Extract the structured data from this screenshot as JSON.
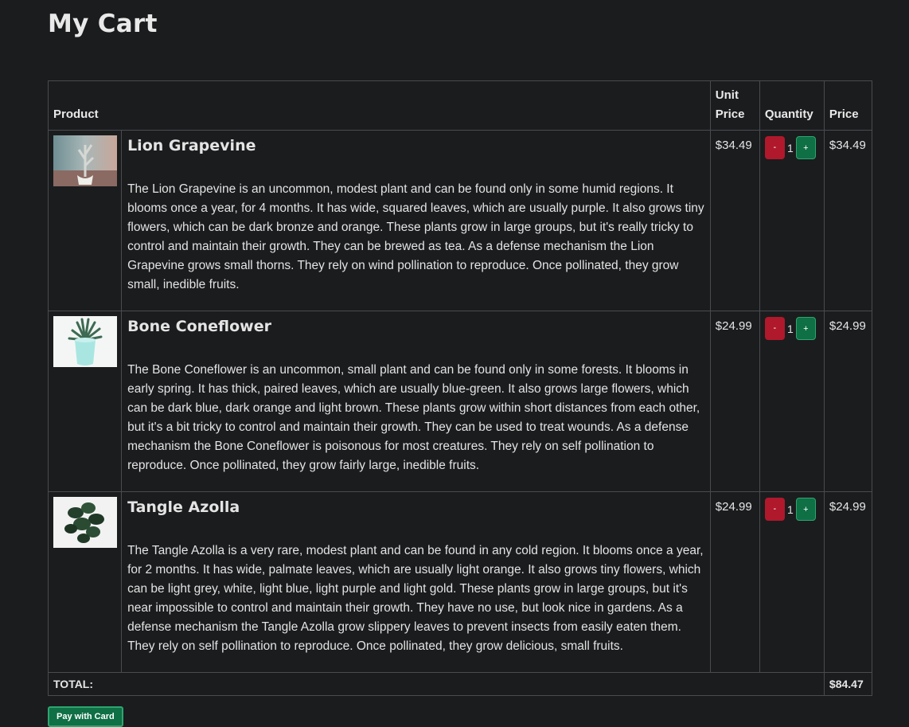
{
  "page": {
    "title": "My Cart"
  },
  "table": {
    "headers": {
      "product": "Product",
      "unit_price": "Unit Price",
      "quantity": "Quantity",
      "price": "Price"
    },
    "minus_label": "-",
    "plus_label": "+",
    "items": [
      {
        "name": "Lion Grapevine",
        "image": "plant-stem-photo",
        "description": "The Lion Grapevine is an uncommon, modest plant and can be found only in some humid regions. It blooms once a year, for 4 months. It has wide, squared leaves, which are usually purple. It also grows tiny flowers, which can be dark bronze and orange. These plants grow in large groups, but it's really tricky to control and maintain their growth. They can be brewed as tea. As a defense mechanism the Lion Grapevine grows small thorns. They rely on wind pollination to reproduce. Once pollinated, they grow small, inedible fruits.",
        "unit_price": "$34.49",
        "quantity": "1",
        "price": "$34.49"
      },
      {
        "name": "Bone Coneflower",
        "image": "succulent-pot-photo",
        "description": "The Bone Coneflower is an uncommon, small plant and can be found only in some forests. It blooms in early spring. It has thick, paired leaves, which are usually blue-green. It also grows large flowers, which can be dark blue, dark orange and light brown. These plants grow within short distances from each other, but it's a bit tricky to control and maintain their growth. They can be used to treat wounds. As a defense mechanism the Bone Coneflower is poisonous for most creatures. They rely on self pollination to reproduce. Once pollinated, they grow fairly large, inedible fruits.",
        "unit_price": "$24.99",
        "quantity": "1",
        "price": "$24.99"
      },
      {
        "name": "Tangle Azolla",
        "image": "leafy-plant-photo",
        "description": "The Tangle Azolla is a very rare, modest plant and can be found in any cold region. It blooms once a year, for 2 months. It has wide, palmate leaves, which are usually light orange. It also grows tiny flowers, which can be light grey, white, light blue, light purple and light gold. These plants grow in large groups, but it's near impossible to control and maintain their growth. They have no use, but look nice in gardens. As a defense mechanism the Tangle Azolla grow slippery leaves to prevent insects from easily eaten them. They rely on self pollination to reproduce. Once pollinated, they grow delicious, small fruits.",
        "unit_price": "$24.99",
        "quantity": "1",
        "price": "$24.99"
      }
    ],
    "total_label": "TOTAL:",
    "total_value": "$84.47"
  },
  "actions": {
    "pay_label": "Pay with Card"
  },
  "colors": {
    "background": "#1b1c1e",
    "minus": "#b0182c",
    "plus": "#0f6f45"
  }
}
